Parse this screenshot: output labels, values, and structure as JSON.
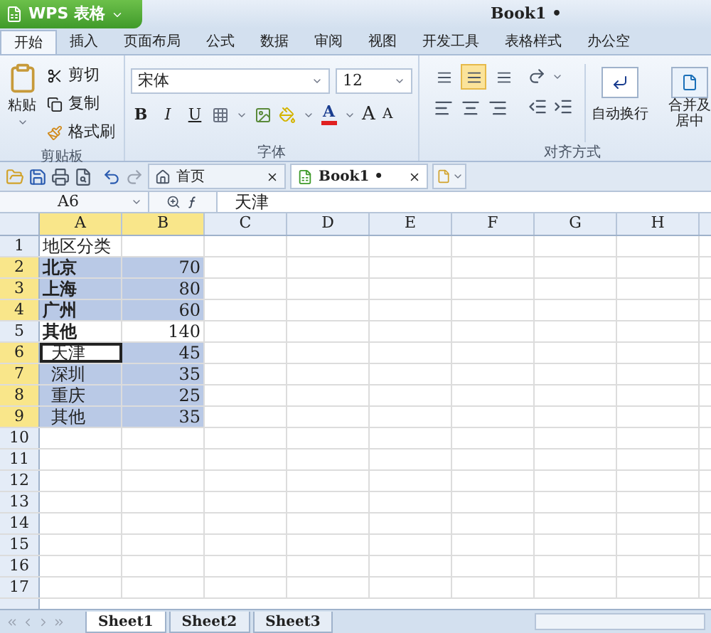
{
  "app_button": {
    "label": "WPS 表格"
  },
  "window": {
    "title": "Book1 •"
  },
  "ribbon_tabs": [
    {
      "label": "开始",
      "selected": true
    },
    {
      "label": "插入",
      "selected": false
    },
    {
      "label": "页面布局",
      "selected": false
    },
    {
      "label": "公式",
      "selected": false
    },
    {
      "label": "数据",
      "selected": false
    },
    {
      "label": "审阅",
      "selected": false
    },
    {
      "label": "视图",
      "selected": false
    },
    {
      "label": "开发工具",
      "selected": false
    },
    {
      "label": "表格样式",
      "selected": false
    },
    {
      "label": "办公空",
      "selected": false
    }
  ],
  "clipboard_group": {
    "title": "剪贴板",
    "paste": "粘贴",
    "cut": "剪切",
    "copy": "复制",
    "format_painter": "格式刷"
  },
  "font_group": {
    "title": "字体",
    "font": "宋体",
    "size": "12",
    "bold": "B",
    "italic": "I",
    "underline": "U",
    "font_color": "A",
    "grow": "A",
    "shrink": "A"
  },
  "alignment_group": {
    "title": "对齐方式",
    "vertical_align": [
      {
        "selected": false
      },
      {
        "selected": true
      },
      {
        "selected": false
      }
    ],
    "wrap": "自动换行",
    "merge": "合并及居中"
  },
  "doc_tabs": [
    {
      "label": "首页",
      "selected": false
    },
    {
      "label": "Book1 •",
      "selected": true
    }
  ],
  "formula_bar": {
    "name_box": "A6",
    "value": "天津"
  },
  "columns": [
    {
      "label": "A",
      "selected": true
    },
    {
      "label": "B",
      "selected": true
    },
    {
      "label": "C",
      "selected": false
    },
    {
      "label": "D",
      "selected": false
    },
    {
      "label": "E",
      "selected": false
    },
    {
      "label": "F",
      "selected": false
    },
    {
      "label": "G",
      "selected": false
    },
    {
      "label": "H",
      "selected": false
    }
  ],
  "rows": [
    {
      "number": "1",
      "label": "地区分类",
      "selected": false,
      "bold": false,
      "indented": false,
      "active": false
    },
    {
      "number": "2",
      "label": "北京",
      "value": "70",
      "selected": true,
      "bold": true,
      "indented": false,
      "active": false
    },
    {
      "number": "3",
      "label": "上海",
      "value": "80",
      "selected": true,
      "bold": true,
      "indented": false,
      "active": false
    },
    {
      "number": "4",
      "label": "广州",
      "value": "60",
      "selected": true,
      "bold": true,
      "indented": false,
      "active": false
    },
    {
      "number": "5",
      "label": "其他",
      "value": "140",
      "selected": false,
      "bold": true,
      "indented": false,
      "active": false
    },
    {
      "number": "6",
      "label": "天津",
      "value": "45",
      "selected": true,
      "bold": false,
      "indented": true,
      "active": true
    },
    {
      "number": "7",
      "label": "深圳",
      "value": "35",
      "selected": true,
      "bold": false,
      "indented": true,
      "active": false
    },
    {
      "number": "8",
      "label": "重庆",
      "value": "25",
      "selected": true,
      "bold": false,
      "indented": true,
      "active": false
    },
    {
      "number": "9",
      "label": "其他",
      "value": "35",
      "selected": true,
      "bold": false,
      "indented": true,
      "active": false
    },
    {
      "number": "10",
      "selected": false
    },
    {
      "number": "11",
      "selected": false
    },
    {
      "number": "12",
      "selected": false
    },
    {
      "number": "13",
      "selected": false
    },
    {
      "number": "14",
      "selected": false
    },
    {
      "number": "15",
      "selected": false
    },
    {
      "number": "16",
      "selected": false
    },
    {
      "number": "17",
      "selected": false
    }
  ],
  "sheet_tabs": [
    {
      "label": "Sheet1",
      "selected": true
    },
    {
      "label": "Sheet2",
      "selected": false
    },
    {
      "label": "Sheet3",
      "selected": false
    }
  ]
}
